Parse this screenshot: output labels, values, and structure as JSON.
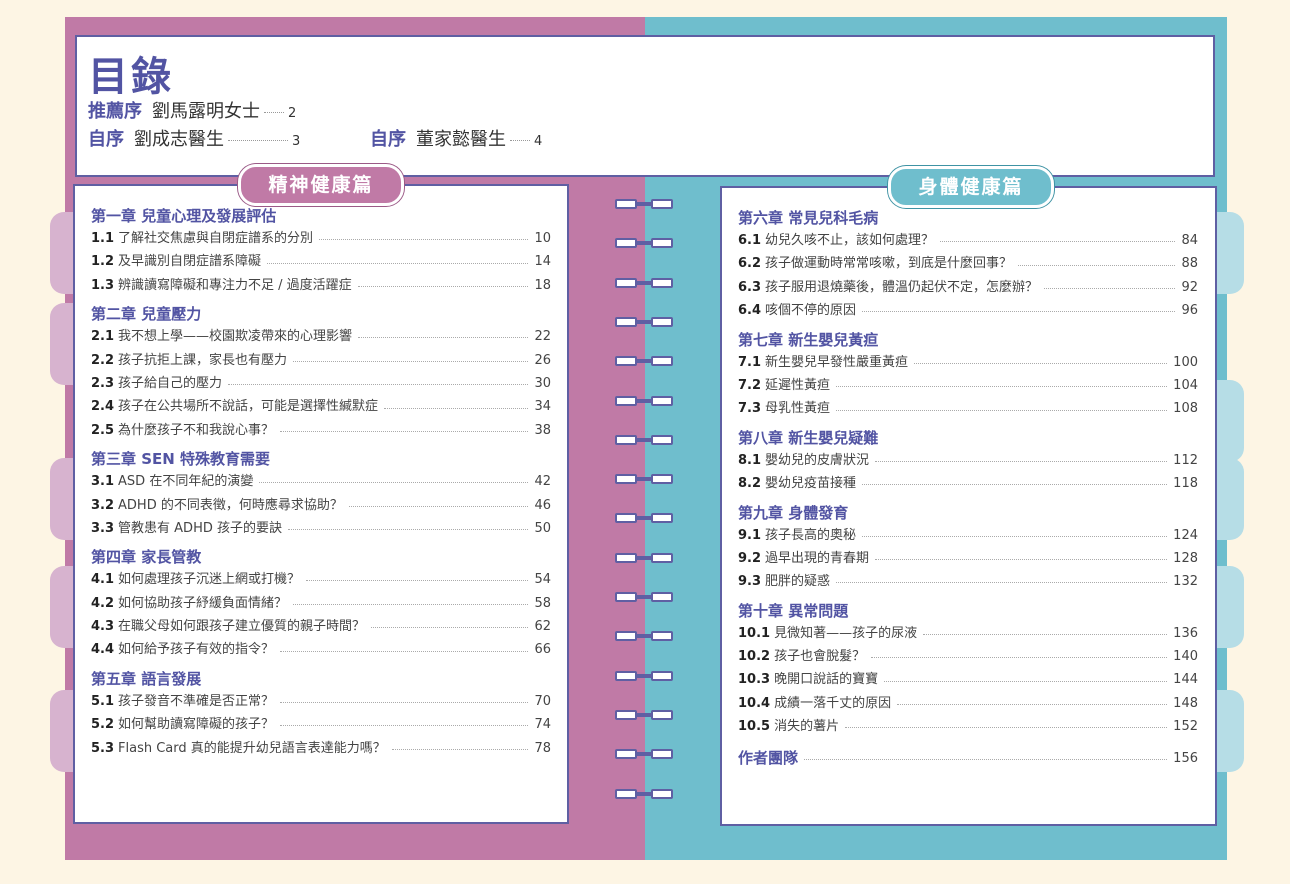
{
  "header": {
    "title": "目錄",
    "prefaces": [
      {
        "label": "推薦序",
        "author": "劉馬露明女士",
        "page": "2"
      },
      {
        "label": "自序",
        "author": "劉成志醫生",
        "page": "3"
      },
      {
        "label": "自序",
        "author": "董家懿醫生",
        "page": "4"
      }
    ]
  },
  "left": {
    "banner": "精神健康篇",
    "chapters": [
      {
        "title": "第一章 兒童心理及發展評估",
        "items": [
          {
            "num": "1.1",
            "text": "了解社交焦慮與自閉症譜系的分別",
            "page": "10"
          },
          {
            "num": "1.2",
            "text": "及早識別自閉症譜系障礙",
            "page": "14"
          },
          {
            "num": "1.3",
            "text": "辨識讀寫障礙和專注力不足 / 過度活躍症",
            "page": "18"
          }
        ]
      },
      {
        "title": "第二章 兒童壓力",
        "items": [
          {
            "num": "2.1",
            "text": "我不想上學——校園欺凌帶來的心理影響",
            "page": "22"
          },
          {
            "num": "2.2",
            "text": "孩子抗拒上課，家長也有壓力",
            "page": "26"
          },
          {
            "num": "2.3",
            "text": "孩子給自己的壓力",
            "page": "30"
          },
          {
            "num": "2.4",
            "text": "孩子在公共場所不說話，可能是選擇性緘默症",
            "page": "34"
          },
          {
            "num": "2.5",
            "text": "為什麼孩子不和我說心事？",
            "page": "38"
          }
        ]
      },
      {
        "title": "第三章 SEN 特殊教育需要",
        "items": [
          {
            "num": "3.1",
            "text": "ASD 在不同年紀的演變",
            "page": "42"
          },
          {
            "num": "3.2",
            "text": "ADHD 的不同表徵，何時應尋求協助？",
            "page": "46"
          },
          {
            "num": "3.3",
            "text": "管教患有 ADHD 孩子的要訣",
            "page": "50"
          }
        ]
      },
      {
        "title": "第四章 家長管教",
        "items": [
          {
            "num": "4.1",
            "text": "如何處理孩子沉迷上網或打機？",
            "page": "54"
          },
          {
            "num": "4.2",
            "text": "如何協助孩子紓緩負面情緒？",
            "page": "58"
          },
          {
            "num": "4.3",
            "text": "在職父母如何跟孩子建立優質的親子時間？",
            "page": "62"
          },
          {
            "num": "4.4",
            "text": "如何給予孩子有效的指令？",
            "page": "66"
          }
        ]
      },
      {
        "title": "第五章 語言發展",
        "items": [
          {
            "num": "5.1",
            "text": "孩子發音不準確是否正常？",
            "page": "70"
          },
          {
            "num": "5.2",
            "text": "如何幫助讀寫障礙的孩子？",
            "page": "74"
          },
          {
            "num": "5.3",
            "text": "Flash Card 真的能提升幼兒語言表達能力嗎？",
            "page": "78"
          }
        ]
      }
    ]
  },
  "right": {
    "banner": "身體健康篇",
    "chapters": [
      {
        "title": "第六章 常見兒科毛病",
        "items": [
          {
            "num": "6.1",
            "text": "幼兒久咳不止，該如何處理？",
            "page": "84"
          },
          {
            "num": "6.2",
            "text": "孩子做運動時常常咳嗽，到底是什麼回事？",
            "page": "88"
          },
          {
            "num": "6.3",
            "text": "孩子服用退燒藥後，體溫仍起伏不定，怎麼辦？",
            "page": "92"
          },
          {
            "num": "6.4",
            "text": "咳個不停的原因",
            "page": "96"
          }
        ]
      },
      {
        "title": "第七章 新生嬰兒黃疸",
        "items": [
          {
            "num": "7.1",
            "text": "新生嬰兒早發性嚴重黃疸",
            "page": "100"
          },
          {
            "num": "7.2",
            "text": "延遲性黃疸",
            "page": "104"
          },
          {
            "num": "7.3",
            "text": "母乳性黃疸",
            "page": "108"
          }
        ]
      },
      {
        "title": "第八章 新生嬰兒疑難",
        "items": [
          {
            "num": "8.1",
            "text": "嬰幼兒的皮膚狀況",
            "page": "112"
          },
          {
            "num": "8.2",
            "text": "嬰幼兒疫苗接種",
            "page": "118"
          }
        ]
      },
      {
        "title": "第九章 身體發育",
        "items": [
          {
            "num": "9.1",
            "text": "孩子長高的奧秘",
            "page": "124"
          },
          {
            "num": "9.2",
            "text": "過早出現的青春期",
            "page": "128"
          },
          {
            "num": "9.3",
            "text": "肥胖的疑惑",
            "page": "132"
          }
        ]
      },
      {
        "title": "第十章 異常問題",
        "items": [
          {
            "num": "10.1",
            "text": "見微知著——孩子的尿液",
            "page": "136"
          },
          {
            "num": "10.2",
            "text": "孩子也會脫髮？",
            "page": "140"
          },
          {
            "num": "10.3",
            "text": "晚開口說話的寶寶",
            "page": "144"
          },
          {
            "num": "10.4",
            "text": "成績一落千丈的原因",
            "page": "148"
          },
          {
            "num": "10.5",
            "text": "消失的薯片",
            "page": "152"
          }
        ]
      }
    ],
    "team": {
      "title": "作者團隊",
      "page": "156"
    }
  }
}
